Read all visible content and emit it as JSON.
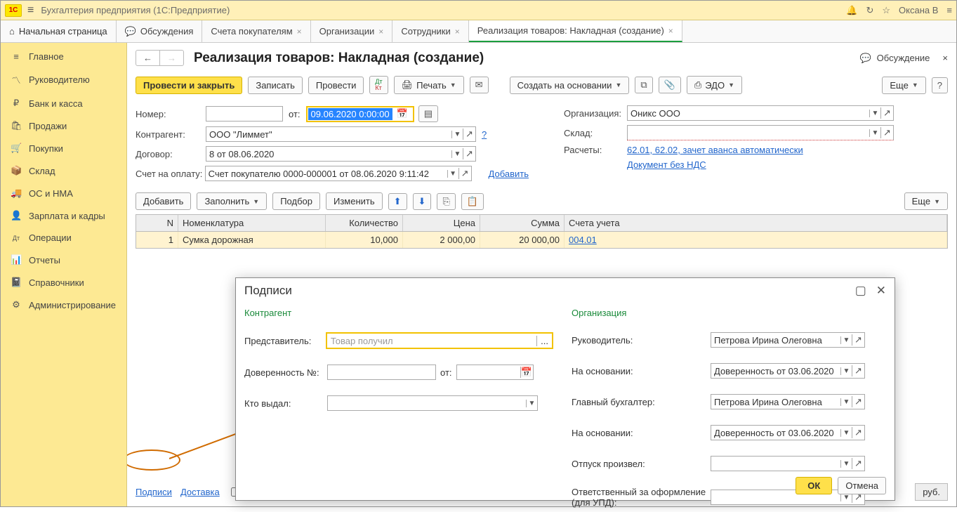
{
  "top": {
    "title": "Бухгалтерия предприятия  (1С:Предприятие)",
    "user": "Оксана В"
  },
  "tabs": {
    "home": "Начальная страница",
    "discuss": "Обсуждения",
    "list": [
      "Счета покупателям",
      "Организации",
      "Сотрудники",
      "Реализация товаров: Накладная (создание)"
    ]
  },
  "sidebar": [
    "Главное",
    "Руководителю",
    "Банк и касса",
    "Продажи",
    "Покупки",
    "Склад",
    "ОС и НМА",
    "Зарплата и кадры",
    "Операции",
    "Отчеты",
    "Справочники",
    "Администрирование"
  ],
  "sidebar_icons": [
    "≡",
    "〽",
    "₽",
    "🛍",
    "🛒",
    "📦",
    "🚚",
    "👤",
    "Дт",
    "📊",
    "📓",
    "⚙"
  ],
  "page_title": "Реализация товаров: Накладная (создание)",
  "discuss_btn": "Обсуждение",
  "toolbar": {
    "post_close": "Провести и закрыть",
    "save": "Записать",
    "post": "Провести",
    "print": "Печать",
    "create_based": "Создать на основании",
    "edo": "ЭДО",
    "more": "Еще"
  },
  "form": {
    "number_l": "Номер:",
    "from_l": "от:",
    "date": "09.06.2020  0:00:00",
    "org_l": "Организация:",
    "org": "Оникс ООО",
    "contr_l": "Контрагент:",
    "contr": "ООО \"Лиммет\"",
    "sklad_l": "Склад:",
    "dog_l": "Договор:",
    "dog": "8 от 08.06.2020",
    "rasch_l": "Расчеты:",
    "rasch": "62.01, 62.02, зачет аванса автоматически",
    "invoice_l": "Счет на оплату:",
    "invoice": "Счет покупателю 0000-000001 от 08.06.2020 9:11:42",
    "add_link": "Добавить",
    "nds_link": "Документ без НДС"
  },
  "sub_tb": {
    "add": "Добавить",
    "fill": "Заполнить",
    "select": "Подбор",
    "change": "Изменить",
    "more": "Еще"
  },
  "grid": {
    "h_n": "N",
    "h_nom": "Номенклатура",
    "h_qty": "Количество",
    "h_price": "Цена",
    "h_sum": "Сумма",
    "h_acc": "Счета учета",
    "r_n": "1",
    "r_nom": "Сумка дорожная",
    "r_qty": "10,000",
    "r_price": "2 000,00",
    "r_sum": "20 000,00",
    "r_acc": "004.01"
  },
  "chart_data": {
    "type": "table",
    "columns": [
      "N",
      "Номенклатура",
      "Количество",
      "Цена",
      "Сумма",
      "Счета учета"
    ],
    "rows": [
      [
        1,
        "Сумка дорожная",
        10.0,
        2000.0,
        20000.0,
        "004.01"
      ]
    ]
  },
  "foot": {
    "signs": "Подписи",
    "delivery": "Доставка",
    "currency": "руб."
  },
  "dlg": {
    "title": "Подписи",
    "sec1": "Контрагент",
    "sec2": "Организация",
    "rep_l": "Представитель:",
    "rep_ph": "Товар получил",
    "dov_l": "Доверенность №:",
    "dov_from": "от:",
    "who_l": "Кто выдал:",
    "dir_l": "Руководитель:",
    "dir": "Петрова Ирина Олеговна",
    "base_l": "На основании:",
    "base": "Доверенность от 03.06.2020",
    "acct_l": "Главный бухгалтер:",
    "acct": "Петрова Ирина Олеговна",
    "base2_l": "На основании:",
    "base2": "Доверенность от 03.06.2020",
    "rel_l": "Отпуск произвел:",
    "resp_l": "Ответственный за оформление (для УПД):",
    "ok": "ОК",
    "cancel": "Отмена"
  }
}
